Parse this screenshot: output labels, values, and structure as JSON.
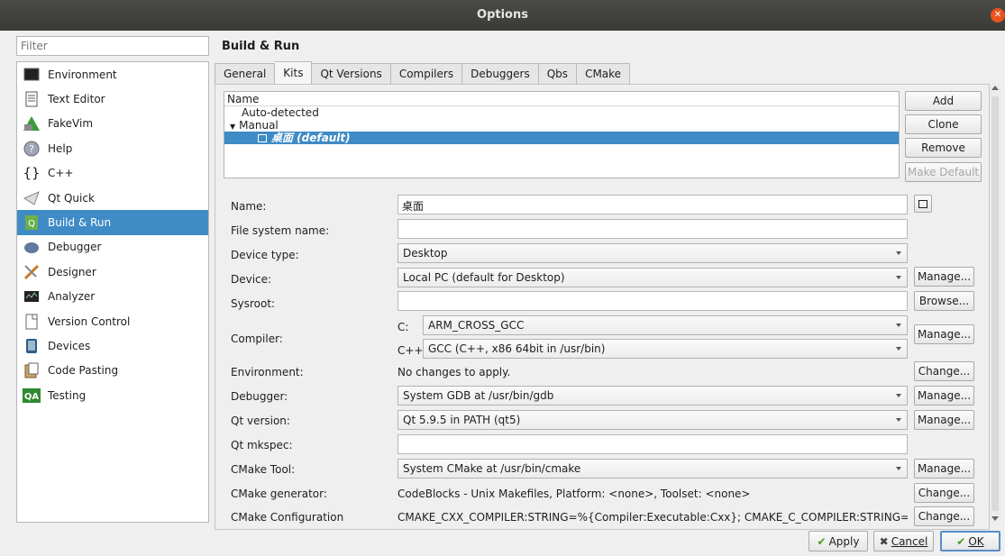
{
  "window": {
    "title": "Options"
  },
  "filter": {
    "placeholder": "Filter"
  },
  "categories": [
    {
      "label": "Environment",
      "icon": "monitor-icon"
    },
    {
      "label": "Text Editor",
      "icon": "document-icon"
    },
    {
      "label": "FakeVim",
      "icon": "fakevim-icon"
    },
    {
      "label": "Help",
      "icon": "help-icon"
    },
    {
      "label": "C++",
      "icon": "braces-icon"
    },
    {
      "label": "Qt Quick",
      "icon": "paper-plane-icon"
    },
    {
      "label": "Build & Run",
      "icon": "build-run-icon",
      "selected": true
    },
    {
      "label": "Debugger",
      "icon": "debugger-icon"
    },
    {
      "label": "Designer",
      "icon": "designer-icon"
    },
    {
      "label": "Analyzer",
      "icon": "analyzer-icon"
    },
    {
      "label": "Version Control",
      "icon": "version-control-icon"
    },
    {
      "label": "Devices",
      "icon": "devices-icon"
    },
    {
      "label": "Code Pasting",
      "icon": "code-pasting-icon"
    },
    {
      "label": "Testing",
      "icon": "qa-icon"
    }
  ],
  "page": {
    "title": "Build & Run",
    "tabs": [
      "General",
      "Kits",
      "Qt Versions",
      "Compilers",
      "Debuggers",
      "Qbs",
      "CMake"
    ],
    "selected_tab": "Kits"
  },
  "kit_tree": {
    "header": "Name",
    "auto_detected": "Auto-detected",
    "manual": "Manual",
    "selected_kit": "桌面 (default)"
  },
  "kit_buttons": {
    "add": "Add",
    "clone": "Clone",
    "remove": "Remove",
    "make_default": "Make Default"
  },
  "form": {
    "name_label": "Name:",
    "name_value": "桌面",
    "fsname_label": "File system name:",
    "fsname_value": "",
    "device_type_label": "Device type:",
    "device_type_value": "Desktop",
    "device_label": "Device:",
    "device_value": "Local PC (default for Desktop)",
    "sysroot_label": "Sysroot:",
    "sysroot_value": "",
    "compiler_label": "Compiler:",
    "compiler_c_label": "C:",
    "compiler_c_value": "ARM_CROSS_GCC",
    "compiler_cxx_label": "C++:",
    "compiler_cxx_value": "GCC (C++, x86 64bit in /usr/bin)",
    "environment_label": "Environment:",
    "environment_value": "No changes to apply.",
    "debugger_label": "Debugger:",
    "debugger_value": "System GDB at /usr/bin/gdb",
    "qt_version_label": "Qt version:",
    "qt_version_value": "Qt 5.9.5 in PATH (qt5)",
    "qt_mkspec_label": "Qt mkspec:",
    "qt_mkspec_value": "",
    "cmake_tool_label": "CMake Tool:",
    "cmake_tool_value": "System CMake at /usr/bin/cmake",
    "cmake_generator_label": "CMake generator:",
    "cmake_generator_value": "CodeBlocks - Unix Makefiles, Platform: <none>, Toolset: <none>",
    "cmake_config_label": "CMake Configuration",
    "cmake_config_value": "CMAKE_CXX_COMPILER:STRING=%{Compiler:Executable:Cxx}; CMAKE_C_COMPILER:STRING=..."
  },
  "row_buttons": {
    "manage": "Manage...",
    "browse": "Browse...",
    "change": "Change..."
  },
  "dialog_buttons": {
    "apply": "Apply",
    "cancel": "Cancel",
    "ok": "OK"
  }
}
